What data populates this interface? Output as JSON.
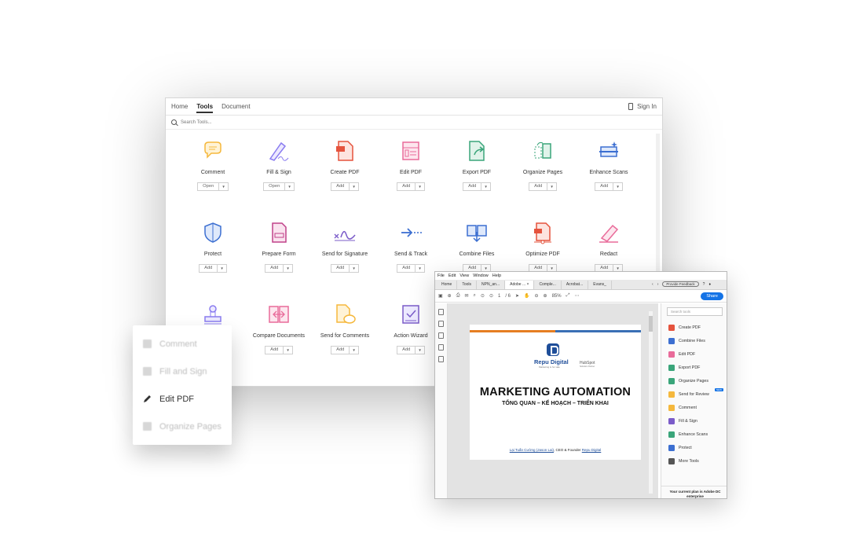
{
  "tools_window": {
    "tabs": [
      "Home",
      "Tools",
      "Document"
    ],
    "active_tab": "Tools",
    "sign_in": "Sign In",
    "search_placeholder": "Search Tools...",
    "tools": [
      {
        "name": "Comment",
        "button": "Open",
        "icon": "comment-icon",
        "color": "#f5b83d"
      },
      {
        "name": "Fill & Sign",
        "button": "Open",
        "icon": "fill-sign-icon",
        "color": "#8a7cf0"
      },
      {
        "name": "Create PDF",
        "button": "Add",
        "icon": "create-pdf-icon",
        "color": "#e5533d"
      },
      {
        "name": "Edit PDF",
        "button": "Add",
        "icon": "edit-pdf-icon",
        "color": "#e96b9a"
      },
      {
        "name": "Export PDF",
        "button": "Add",
        "icon": "export-pdf-icon",
        "color": "#3aa57a"
      },
      {
        "name": "Organize Pages",
        "button": "Add",
        "icon": "organize-pages-icon",
        "color": "#3aa57a"
      },
      {
        "name": "Enhance Scans",
        "button": "Add",
        "icon": "enhance-scans-icon",
        "color": "#3c6fd1"
      },
      {
        "name": "Protect",
        "button": "Add",
        "icon": "shield-icon",
        "color": "#3c6fd1"
      },
      {
        "name": "Prepare Form",
        "button": "Add",
        "icon": "prepare-form-icon",
        "color": "#c0428a"
      },
      {
        "name": "Send for Signature",
        "button": "Add",
        "icon": "send-signature-icon",
        "color": "#7b5cc9"
      },
      {
        "name": "Send & Track",
        "button": "Add",
        "icon": "send-track-icon",
        "color": "#3c6fd1"
      },
      {
        "name": "Combine Files",
        "button": "Add",
        "icon": "combine-files-icon",
        "color": "#3c6fd1"
      },
      {
        "name": "Optimize PDF",
        "button": "Add",
        "icon": "optimize-pdf-icon",
        "color": "#e5533d"
      },
      {
        "name": "Redact",
        "button": "Add",
        "icon": "redact-icon",
        "color": "#e96b9a"
      },
      {
        "name": "",
        "button": "",
        "icon": "stamp-icon",
        "color": "#8a7cf0"
      },
      {
        "name": "Compare Documents",
        "button": "Add",
        "icon": "compare-icon",
        "color": "#e96b9a"
      },
      {
        "name": "Send for Comments",
        "button": "Add",
        "icon": "send-comments-icon",
        "color": "#f5b83d"
      },
      {
        "name": "Action Wizard",
        "button": "Add",
        "icon": "action-wizard-icon",
        "color": "#7b5cc9"
      }
    ]
  },
  "popover": {
    "items": [
      {
        "label": "Comment",
        "icon": "comment-icon",
        "active": false
      },
      {
        "label": "Fill and Sign",
        "icon": "fill-sign-icon",
        "active": false
      },
      {
        "label": "Edit PDF",
        "icon": "pencil-icon",
        "active": true
      },
      {
        "label": "Organize Pages",
        "icon": "organize-pages-icon",
        "active": false
      }
    ]
  },
  "acrobat_window": {
    "menu": [
      "File",
      "Edit",
      "View",
      "Window",
      "Help"
    ],
    "tabs": [
      "Home",
      "Tools",
      "NPN_an...",
      "Adobe ...",
      "Comple...",
      "Acrobat...",
      "Evans_"
    ],
    "active_tab": "Adobe ...",
    "feedback": "Provide Feedback",
    "page_current": "1",
    "page_total": "/ 6",
    "zoom": "85%",
    "share": "Share",
    "document": {
      "brand": "Repu Digital",
      "brand_tagline": "Marketing is for sale",
      "partner": "HubSpot",
      "partner_tagline": "Solutions Partner",
      "title": "MARKETING AUTOMATION",
      "subtitle": "TỔNG QUAN – KẾ HOẠCH – TRIỂN KHAI",
      "author_name": "Lại Tuấn Cường (Jason Lai)",
      "author_role": ", CEO & Founder ",
      "author_company": "Repu Digital"
    },
    "right_panel": {
      "search_placeholder": "Search tools",
      "items": [
        {
          "label": "Create PDF",
          "color": "#e5533d"
        },
        {
          "label": "Combine Files",
          "color": "#3c6fd1"
        },
        {
          "label": "Edit PDF",
          "color": "#e96b9a"
        },
        {
          "label": "Export PDF",
          "color": "#3aa57a"
        },
        {
          "label": "Organize Pages",
          "color": "#3aa57a"
        },
        {
          "label": "Send for Review",
          "color": "#f5b83d",
          "badge": "NEW"
        },
        {
          "label": "Comment",
          "color": "#f5b83d"
        },
        {
          "label": "Fill & Sign",
          "color": "#7b5cc9"
        },
        {
          "label": "Enhance Scans",
          "color": "#3aa57a"
        },
        {
          "label": "Protect",
          "color": "#3c6fd1"
        },
        {
          "label": "More Tools",
          "color": "#555555"
        }
      ],
      "plan": "Your current plan is Adobe DC enterprise"
    }
  }
}
